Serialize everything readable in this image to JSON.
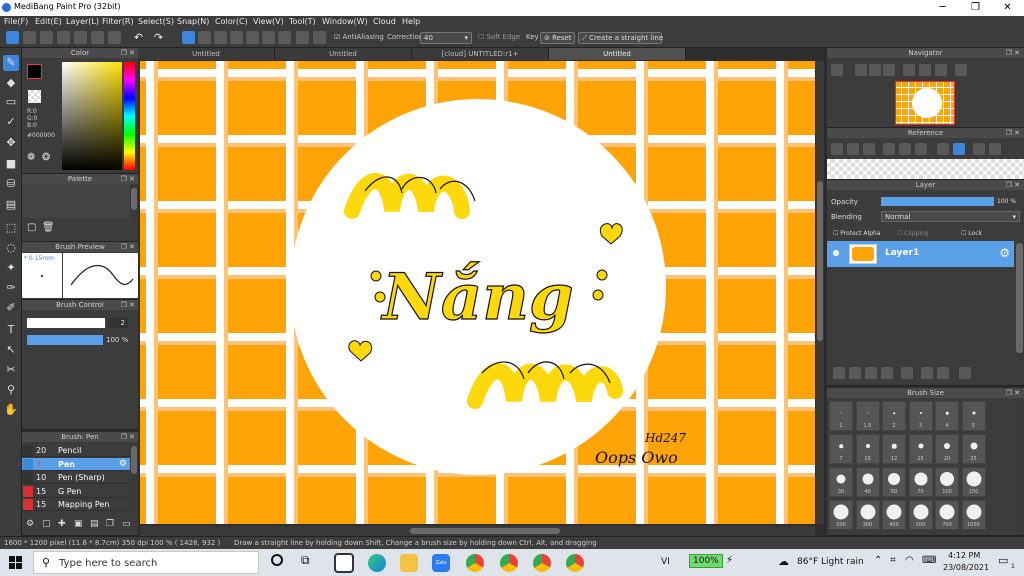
{
  "window": {
    "title": "MediBang Paint Pro (32bit)",
    "minimize": "─",
    "maximize": "❐",
    "close": "✕"
  },
  "menu": [
    "File(F)",
    "Edit(E)",
    "Layer(L)",
    "Filter(R)",
    "Select(S)",
    "Snap(N)",
    "Color(C)",
    "View(V)",
    "Tool(T)",
    "Window(W)",
    "Cloud",
    "Help"
  ],
  "toolbar": {
    "antialiasing": "AntiAliasing",
    "correction_label": "Correction",
    "correction_value": "40",
    "soft_edge": "Soft Edge",
    "key": "Key",
    "reset": "Reset",
    "straight_line": "Create a straight line"
  },
  "panels": {
    "color": "Color",
    "palette": "Palette",
    "brush_preview": "Brush Preview",
    "brush_control": "Brush Control",
    "brush_list": "Brush: Pen",
    "navigator": "Navigator",
    "reference": "Reference",
    "layer": "Layer",
    "brush_size": "Brush Size"
  },
  "color": {
    "r": "R:0",
    "g": "G:0",
    "b": "B:0",
    "hex": "#000000",
    "primary": "#000000",
    "secondary": "#ffffff"
  },
  "brush_preview": {
    "size": "0.15mm"
  },
  "brush_control": {
    "size": "2",
    "opacity": "100 %"
  },
  "brushes": [
    {
      "size": "20",
      "name": "Pencil",
      "color": "#333333",
      "selected": false
    },
    {
      "size": "3",
      "name": "Pen",
      "color": "#3e86d8",
      "selected": true
    },
    {
      "size": "10",
      "name": "Pen (Sharp)",
      "color": "#333333",
      "selected": false
    },
    {
      "size": "15",
      "name": "G Pen",
      "color": "#d83030",
      "selected": false
    },
    {
      "size": "15",
      "name": "Mapping Pen",
      "color": "#d83030",
      "selected": false
    }
  ],
  "tabs": [
    "Untitled",
    "Untitled",
    "[cloud] UNTITLED:r1+",
    "Untitled"
  ],
  "artwork": {
    "main_text": "Nắng",
    "signature_top": "Hd247",
    "signature_bottom": "Oops Owo",
    "accent": "#fdd80a",
    "background": "#fea406"
  },
  "layer": {
    "opacity_label": "Opacity",
    "opacity_value": "100 %",
    "blending_label": "Blending",
    "blending_value": "Normal",
    "protect_alpha": "Protect Alpha",
    "clipping": "Clipping",
    "lock": "Lock",
    "layer_name": "Layer1"
  },
  "brush_sizes": [
    "1",
    "1.5",
    "2",
    "3",
    "4",
    "5",
    "7",
    "10",
    "12",
    "15",
    "20",
    "25",
    "30",
    "40",
    "50",
    "70",
    "100",
    "150",
    "200",
    "300",
    "400",
    "500",
    "700",
    "1000"
  ],
  "status": {
    "dimensions": "1600 * 1200 pixel  (11.6 * 8.7cm)  350 dpi  100 %  ( 1428, 932 )",
    "hint": "Draw a straight line by holding down Shift, Change a brush size by holding down Ctrl, Alt, and dragging"
  },
  "taskbar": {
    "search_placeholder": "Type here to search",
    "language": "VI",
    "battery": "100%",
    "weather": "86°F  Light rain",
    "time": "4:12 PM",
    "date": "23/08/2021",
    "notifications": "1"
  }
}
